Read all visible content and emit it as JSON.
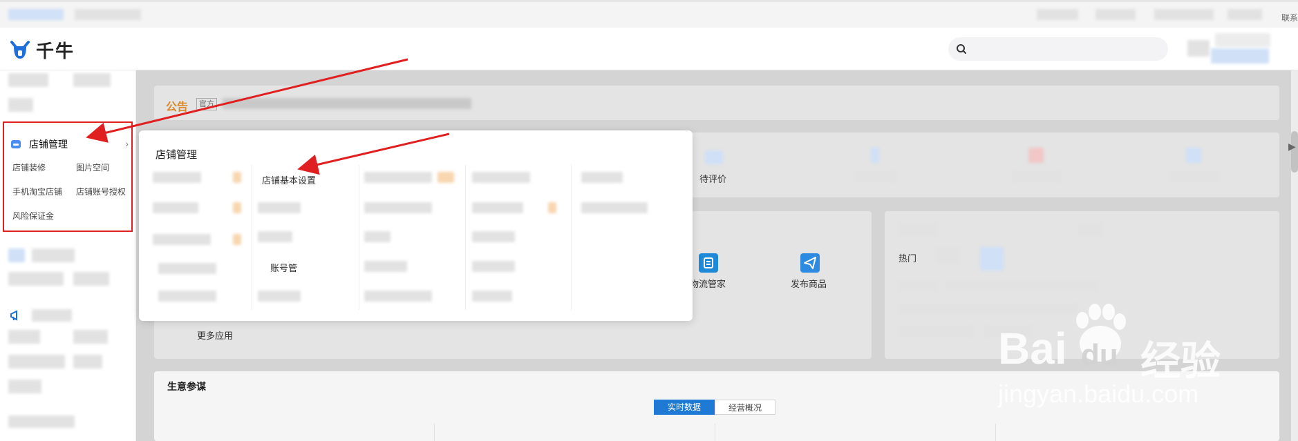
{
  "top_bar": {
    "right_text": "联系"
  },
  "header": {
    "brand": "千牛",
    "search_placeholder": ""
  },
  "sidebar": {
    "store_management": "店铺管理",
    "sub_items": [
      "店铺装修",
      "图片空间",
      "手机淘宝店铺",
      "店铺账号授权",
      "风险保证金"
    ]
  },
  "announcement": {
    "label": "公告",
    "tag": "官方"
  },
  "stats": [
    {
      "label": "待评价"
    }
  ],
  "apps": [
    {
      "label": "物流管家",
      "icon": "logistics-icon"
    },
    {
      "label": "发布商品",
      "icon": "send-icon"
    }
  ],
  "more_apps": "更多应用",
  "right_panel": {
    "hot": "热门"
  },
  "popup": {
    "title": "店铺管理",
    "store_basic_settings": "店铺基本设置",
    "account_management": "账号管"
  },
  "business": {
    "title": "生意参谋",
    "tab_realtime": "实时数据",
    "tab_overview": "经营概况"
  },
  "watermark": {
    "brand_left": "Bai",
    "brand_right": "du",
    "jingyan": "经验",
    "url": "jingyan.baidu.com"
  },
  "colors": {
    "accent_blue": "#1f7ad6",
    "notice_orange": "#d98a2a",
    "highlight_red": "#e02020"
  }
}
